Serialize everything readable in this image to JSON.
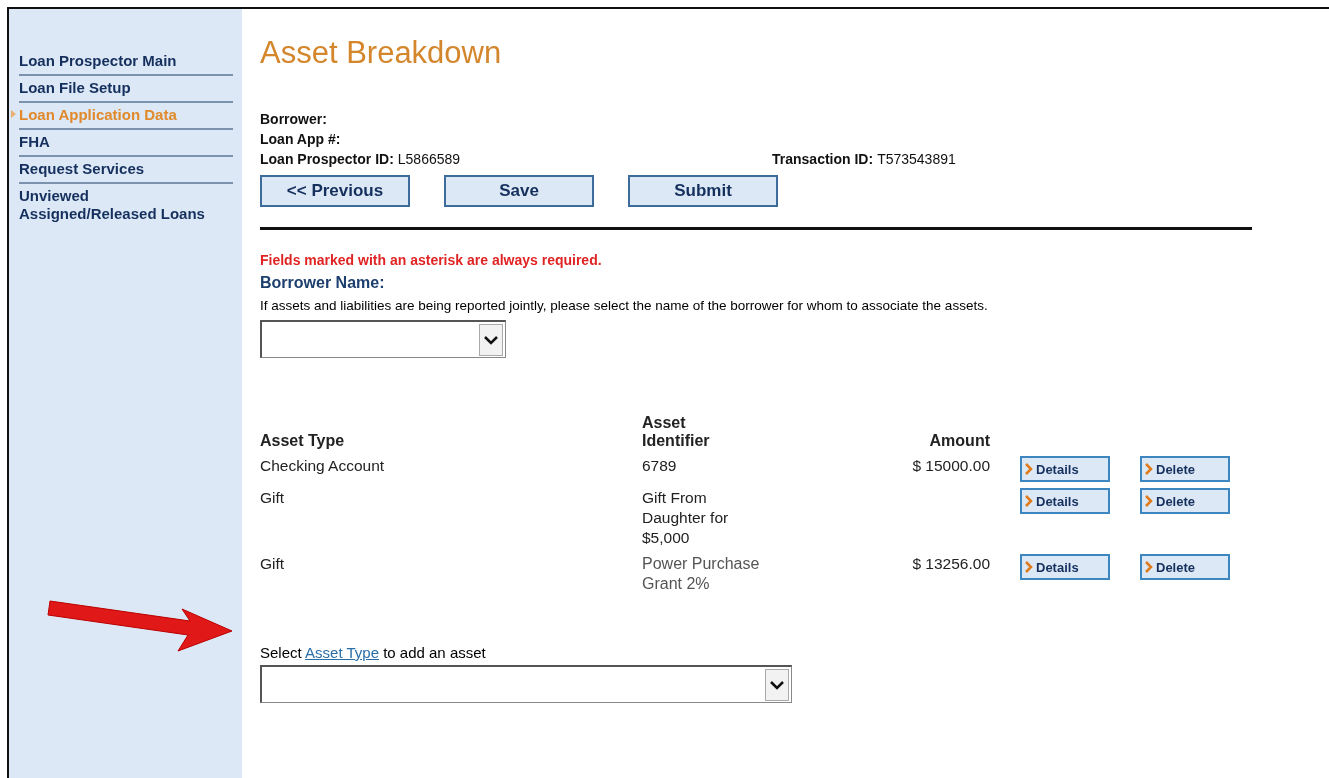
{
  "sidebar": {
    "items": [
      {
        "label": "Loan Prospector Main",
        "selected": false
      },
      {
        "label": "Loan File Setup",
        "selected": false
      },
      {
        "label": "Loan Application Data",
        "selected": true
      },
      {
        "label": "FHA",
        "selected": false
      },
      {
        "label": "Request Services",
        "selected": false
      },
      {
        "label": "Unviewed Assigned/Released Loans",
        "selected": false
      }
    ]
  },
  "page_title": "Asset Breakdown",
  "info": [
    {
      "label": "Borrower:"
    },
    {
      "label": "Loan App #:"
    }
  ],
  "ids": [
    {
      "label": "Loan Prospector ID:",
      "value": "L5866589"
    },
    {
      "label": "Transaction ID:",
      "value": "T573543891"
    }
  ],
  "buttons": [
    "<< Previous",
    "Save",
    "Submit"
  ],
  "required_note": "Fields marked with an asterisk are always required.",
  "borrower_name": {
    "label": "Borrower Name:",
    "help": "If assets and liabilities are being reported jointly, please select the name of the borrower for whom to associate the assets."
  },
  "table": {
    "columns": [
      "Asset Type",
      "Asset Identifier",
      "Amount"
    ],
    "rows": [
      {
        "type": "Checking Account",
        "identifier": "6789",
        "amount": "$ 15000.00",
        "actions": [
          "Details",
          "Delete"
        ],
        "highlighted": false
      },
      {
        "type": "Gift",
        "identifier": "Gift From Daughter for $5,000",
        "amount": "",
        "actions": [
          "Details",
          "Delete"
        ],
        "highlighted": false
      },
      {
        "type": "Gift",
        "identifier": "Power Purchase Grant 2%",
        "amount": "$ 13256.00",
        "actions": [
          "Details",
          "Delete"
        ],
        "highlighted": true
      }
    ]
  },
  "add_asset": {
    "before": "Select",
    "link": "Asset Type",
    "after": "to add an asset"
  }
}
